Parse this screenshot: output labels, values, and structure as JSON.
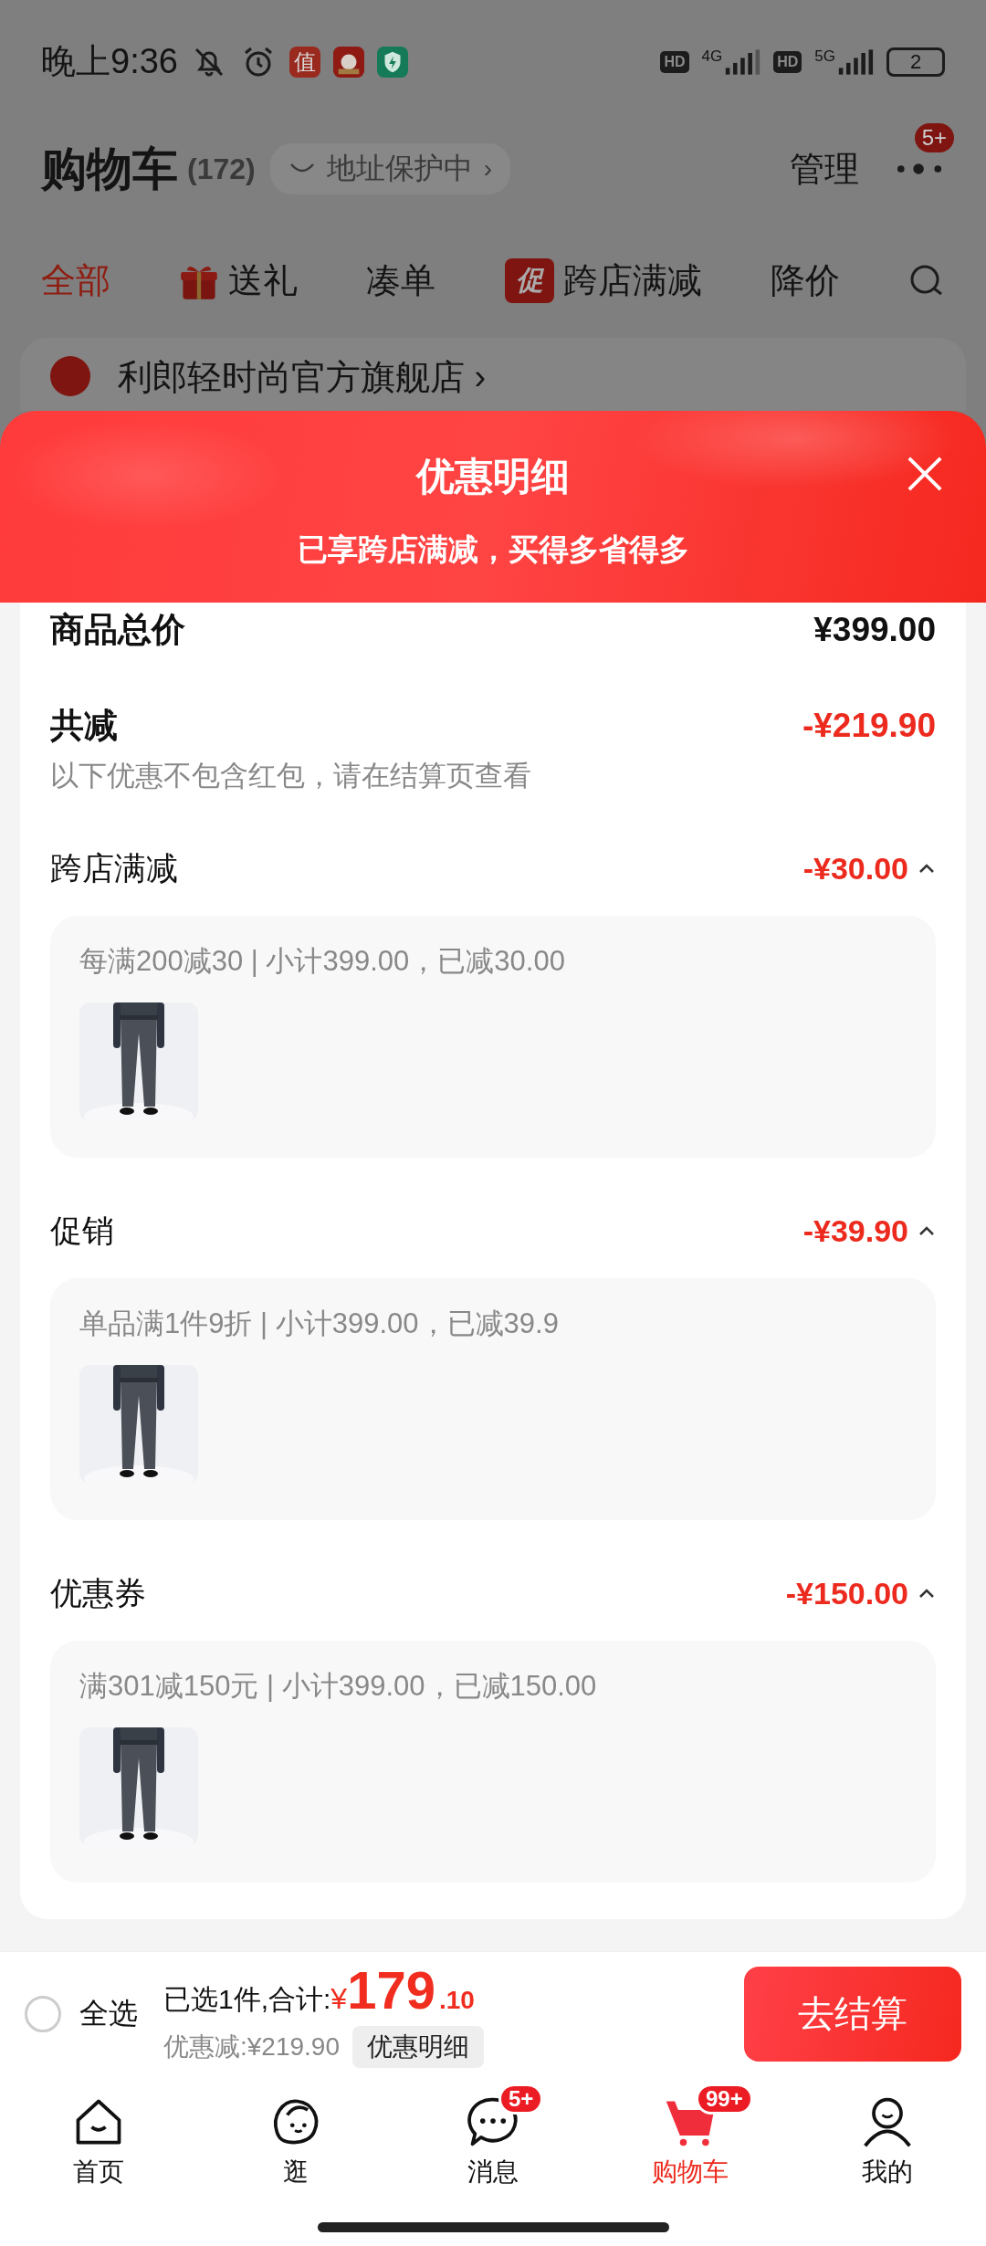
{
  "status_bar": {
    "time": "晚上9:36",
    "app_badge": "值",
    "signals": [
      {
        "hd": "HD",
        "type": "4G"
      },
      {
        "hd": "HD",
        "type": "5G"
      }
    ],
    "battery": "2"
  },
  "header": {
    "title": "购物车",
    "count": "(172)",
    "address_chip": "地址保护中",
    "chip_chevron": "›",
    "manage": "管理",
    "more_badge": "5+"
  },
  "tabs": [
    {
      "label": "全部",
      "selected": true,
      "kind": "plain"
    },
    {
      "label": "送礼",
      "selected": false,
      "kind": "gift"
    },
    {
      "label": "凑单",
      "selected": false,
      "kind": "plain"
    },
    {
      "label": "跨店满减",
      "selected": false,
      "kind": "promo",
      "tag": "促"
    },
    {
      "label": "降价",
      "selected": false,
      "kind": "plain"
    }
  ],
  "store": {
    "name": "利郎轻时尚官方旗舰店",
    "chevron": "›"
  },
  "sheet": {
    "title": "优惠明细",
    "subtitle": "已享跨店满减，买得多省得多",
    "total": {
      "label": "商品总价",
      "value": "¥399.00"
    },
    "reduction": {
      "label": "共减",
      "value": "-¥219.90",
      "note": "以下优惠不包含红包，请在结算页查看"
    },
    "sections": [
      {
        "title": "跨店满减",
        "amount": "-¥30.00",
        "expanded": true,
        "rule": "每满200减30 | 小计399.00，已减30.00"
      },
      {
        "title": "促销",
        "amount": "-¥39.90",
        "expanded": true,
        "rule": "单品满1件9折 | 小计399.00，已减39.9"
      },
      {
        "title": "优惠券",
        "amount": "-¥150.00",
        "expanded": true,
        "rule": "满301减150元 | 小计399.00，已减150.00"
      }
    ]
  },
  "bottom_bar": {
    "select_all": {
      "label": "全选",
      "checked": false
    },
    "summary": "已选1件,合计:",
    "currency": "¥",
    "integer": "179",
    "decimal": ".10",
    "discount": "优惠减:¥219.90",
    "detail_button": "优惠明细",
    "checkout": "去结算"
  },
  "nav": [
    {
      "label": "首页",
      "kind": "home",
      "selected": false
    },
    {
      "label": "逛",
      "kind": "browse",
      "selected": false
    },
    {
      "label": "消息",
      "kind": "message",
      "selected": false,
      "badge": "5+"
    },
    {
      "label": "购物车",
      "kind": "cart",
      "selected": true,
      "badge": "99+"
    },
    {
      "label": "我的",
      "kind": "me",
      "selected": false
    }
  ]
}
